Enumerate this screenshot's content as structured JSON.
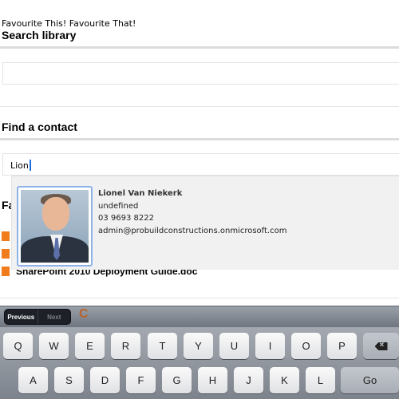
{
  "app": {
    "title": "Favourite This! Favourite That!"
  },
  "search": {
    "heading": "Search library",
    "value": ""
  },
  "contact": {
    "heading": "Find a contact",
    "input_value": "Lion"
  },
  "library": {
    "heading_partial": "Fa",
    "document_name": "SharePoint 2010 Deployment Guide.doc"
  },
  "suggestion": {
    "name": "Lionel Van Niekerk",
    "title": "undefined",
    "phone": "03 9693 8222",
    "email": "admin@probuildconstructions.onmicrosoft.com"
  },
  "partial_text": "C",
  "form_assistant": {
    "previous": "Previous",
    "next": "Next"
  },
  "keyboard": {
    "row1": [
      "Q",
      "W",
      "E",
      "R",
      "T",
      "Y",
      "U",
      "I",
      "O",
      "P"
    ],
    "row2": [
      "A",
      "S",
      "D",
      "F",
      "G",
      "H",
      "J",
      "K",
      "L"
    ],
    "go": "Go"
  },
  "colors": {
    "accent_orange": "#f07c1c",
    "caret_blue": "#1f6fe0",
    "photo_border": "#8fb2e8"
  }
}
